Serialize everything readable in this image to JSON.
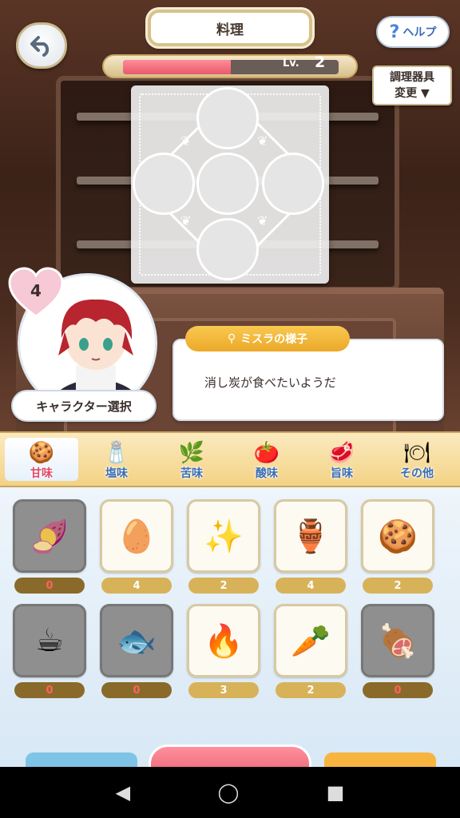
{
  "header": {
    "title": "料理",
    "help_label": "ヘルプ",
    "help_glyph": "?",
    "level_label": "Lv.",
    "level_value": "2",
    "level_progress": 0.5,
    "tool_label_line1": "調理器具",
    "tool_label_line2": "変更"
  },
  "character": {
    "affection": "4",
    "select_label": "キャラクター選択"
  },
  "dialog": {
    "tag": "ミスラの様子",
    "text": "消し炭が食べたいようだ"
  },
  "tabs": [
    {
      "label": "甘味",
      "icon": "sweet-cookies-icon",
      "glyph": "🍪",
      "active": true
    },
    {
      "label": "塩味",
      "icon": "salt-icon",
      "glyph": "🧂",
      "active": false
    },
    {
      "label": "苦味",
      "icon": "herbs-icon",
      "glyph": "🌿",
      "active": false
    },
    {
      "label": "酸味",
      "icon": "tomato-icon",
      "glyph": "🍅",
      "active": false
    },
    {
      "label": "旨味",
      "icon": "meat-icon",
      "glyph": "🥩",
      "active": false
    },
    {
      "label": "その他",
      "icon": "other-icon",
      "glyph": "🍽",
      "active": false
    }
  ],
  "ingredients": [
    {
      "icon": "sweet-potato-icon",
      "glyph": "🍠",
      "qty": "0",
      "dim": true
    },
    {
      "icon": "eggs-icon",
      "glyph": "🥚",
      "qty": "4",
      "dim": false
    },
    {
      "icon": "star-candies-icon",
      "glyph": "✨",
      "qty": "2",
      "dim": false
    },
    {
      "icon": "gourd-icon",
      "glyph": "🏺",
      "qty": "4",
      "dim": false
    },
    {
      "icon": "cookies-icon",
      "glyph": "🍪",
      "qty": "2",
      "dim": false
    },
    {
      "icon": "mug-icon",
      "glyph": "☕",
      "qty": "0",
      "dim": true
    },
    {
      "icon": "fish-bones-icon",
      "glyph": "🐟",
      "qty": "0",
      "dim": true
    },
    {
      "icon": "flaming-potatoes-icon",
      "glyph": "🔥",
      "qty": "3",
      "dim": false
    },
    {
      "icon": "carrot-icon",
      "glyph": "🥕",
      "qty": "2",
      "dim": false
    },
    {
      "icon": "meat-chunk-icon",
      "glyph": "🍖",
      "qty": "0",
      "dim": true
    }
  ],
  "colors": {
    "accent_pink": "#e85a6c",
    "accent_gold": "#d7b259",
    "tab_blue": "#3a6db5"
  }
}
